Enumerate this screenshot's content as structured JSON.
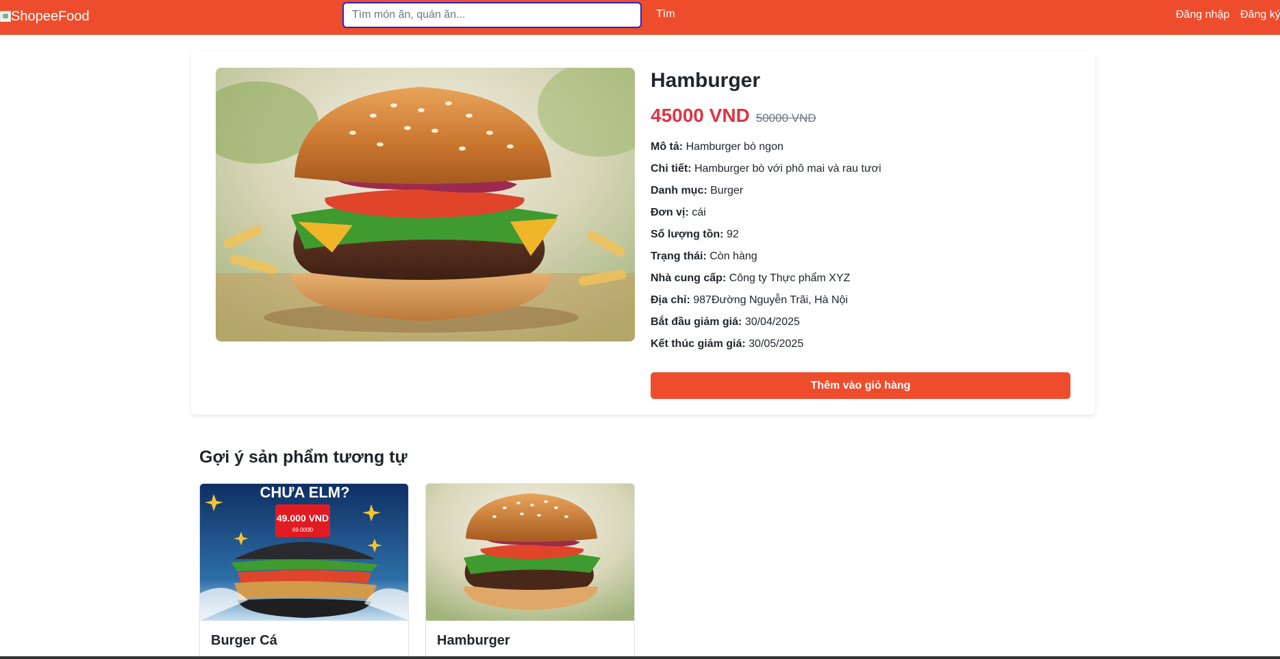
{
  "header": {
    "logo_alt": "ShopeeFood",
    "search_placeholder": "Tìm món ăn, quán ăn...",
    "search_button": "Tìm",
    "login": "Đăng nhập",
    "register": "Đăng ký",
    "brand_color": "#ee4d2d"
  },
  "product": {
    "name": "Hamburger",
    "price": "45000 VND",
    "old_price": "50000 VND",
    "info": [
      {
        "label": "Mô tả:",
        "value": "Hamburger bò ngon"
      },
      {
        "label": "Chi tiết:",
        "value": "Hamburger bò với phô mai và rau tươi"
      },
      {
        "label": "Danh mục:",
        "value": "Burger"
      },
      {
        "label": "Đơn vị:",
        "value": "cái"
      },
      {
        "label": "Số lượng tồn:",
        "value": "92"
      },
      {
        "label": "Trạng thái:",
        "value": "Còn hàng"
      },
      {
        "label": "Nhà cung cấp:",
        "value": "Công ty Thực phẩm XYZ"
      },
      {
        "label": "Địa chỉ:",
        "value": "987Đường Nguyễn Trãi, Hà Nội"
      },
      {
        "label": "Bắt đầu giảm giá:",
        "value": "30/04/2025"
      },
      {
        "label": "Kết thúc giảm giá:",
        "value": "30/05/2025"
      }
    ],
    "add_to_cart": "Thêm vào giỏ hàng",
    "price_color": "#dc3545"
  },
  "suggestions": {
    "title": "Gợi ý sản phẩm tương tự",
    "items": [
      {
        "name": "Burger Cá",
        "poster_text": "CHƯA ELM?",
        "poster_price": "49.000 VND",
        "poster_subprice": "69.000Đ"
      },
      {
        "name": "Hamburger"
      }
    ]
  }
}
